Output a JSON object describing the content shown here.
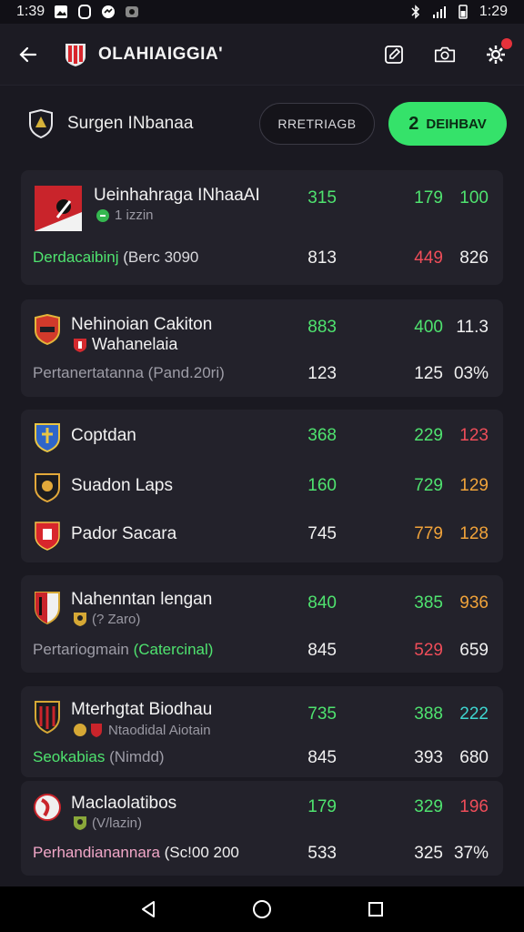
{
  "status_bar": {
    "time_left": "1:39",
    "time_right": "1:29"
  },
  "app_bar": {
    "title": "OLAHIAIGGIA'"
  },
  "filter": {
    "label": "Surgen INbanaa",
    "outline_button": "RRETRIAGB",
    "green_button": "DEIHBAV",
    "green_button_glyph": "2"
  },
  "colors": {
    "accent_green": "#35e26a",
    "red": "#ef4d59",
    "orange": "#f0a33a",
    "cyan": "#3fd6d0"
  },
  "cards": [
    {
      "rows": [
        {
          "name": "Ueinhahraga INhaaAI",
          "sub": "1 izzin",
          "sub_icon": "green-dot-icon",
          "values": [
            "315",
            "179",
            "100"
          ],
          "colors": [
            "green",
            "green",
            "green"
          ]
        }
      ],
      "footer": {
        "label": "Derdacaibinj",
        "label2": "(Berc 3090",
        "values": [
          "813",
          "449",
          "826"
        ],
        "label_color": "green",
        "value_colors": [
          "white",
          "red",
          "white"
        ]
      }
    },
    {
      "rows": [
        {
          "name": "Nehinoian Cakiton",
          "sub": "Wahanelaia",
          "sub_icon": "red-shield-icon",
          "values": [
            "883",
            "400",
            "11.3"
          ],
          "colors": [
            "green",
            "green",
            "white"
          ]
        }
      ],
      "footer": {
        "label": "Pertanertatanna",
        "label2": "(Pand.20ri)",
        "values": [
          "123",
          "125",
          "03%"
        ],
        "label_color": "grey",
        "value_colors": [
          "white",
          "white",
          "white"
        ]
      }
    },
    {
      "rows": [
        {
          "name": "Coptdan",
          "values": [
            "368",
            "229",
            "123"
          ],
          "colors": [
            "green",
            "green",
            "red"
          ]
        },
        {
          "name": "Suadon Laps",
          "values": [
            "160",
            "729",
            "129"
          ],
          "colors": [
            "green",
            "green",
            "orange"
          ]
        },
        {
          "name": "Pador Sacara",
          "values": [
            "745",
            "779",
            "128"
          ],
          "colors": [
            "white",
            "orange",
            "orange"
          ]
        }
      ]
    },
    {
      "rows": [
        {
          "name": "Nahenntan lengan",
          "sub": "(? Zaro)",
          "sub_icon": "gold-shield-icon",
          "values": [
            "840",
            "385",
            "936"
          ],
          "colors": [
            "green",
            "green",
            "orange"
          ]
        }
      ],
      "footer": {
        "label": "Pertariogmain",
        "label2": "(Catercinal)",
        "values": [
          "845",
          "529",
          "659"
        ],
        "label_color": "grey",
        "label2_color": "green",
        "value_colors": [
          "white",
          "red",
          "white"
        ]
      }
    },
    {
      "rows": [
        {
          "name": "Mterhgtat Biodhau",
          "sub": "Ntaodidal Aiotain",
          "sub_icon": "gold-red-badges-icon",
          "values": [
            "735",
            "388",
            "222"
          ],
          "colors": [
            "green",
            "green",
            "cyan"
          ]
        }
      ],
      "footer": {
        "label": "Seokabias",
        "label2": "(Nimdd)",
        "values": [
          "845",
          "393",
          "680"
        ],
        "label_color": "green",
        "label2_color": "grey",
        "value_colors": [
          "white",
          "white",
          "white"
        ]
      }
    },
    {
      "rows": [
        {
          "name": "Maclaolatibos",
          "sub": "(V/lazin)",
          "sub_icon": "gold-shield-icon",
          "values": [
            "179",
            "329",
            "196"
          ],
          "colors": [
            "green",
            "green",
            "red"
          ]
        }
      ],
      "footer": {
        "label": "Perhandianannara",
        "label2": "(Sc!00 200",
        "values": [
          "533",
          "325",
          "37%"
        ],
        "label_color": "pink",
        "value_colors": [
          "white",
          "white",
          "white"
        ]
      }
    }
  ]
}
